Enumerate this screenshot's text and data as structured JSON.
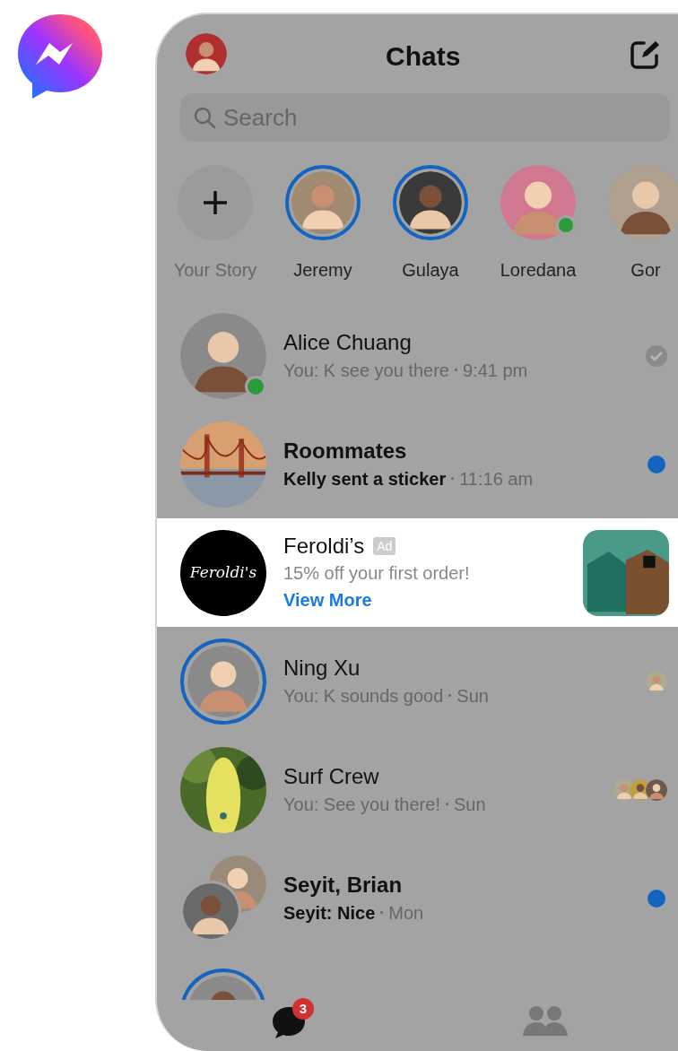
{
  "header": {
    "title": "Chats"
  },
  "search": {
    "placeholder": "Search"
  },
  "stories": [
    {
      "kind": "add",
      "name": "Your Story"
    },
    {
      "kind": "story",
      "name": "Jeremy",
      "unseen": true,
      "online": false
    },
    {
      "kind": "story",
      "name": "Gulaya",
      "unseen": true,
      "online": false
    },
    {
      "kind": "story",
      "name": "Loredana",
      "unseen": false,
      "online": true
    },
    {
      "kind": "story",
      "name": "Gor",
      "unseen": false,
      "online": false
    }
  ],
  "chats": [
    {
      "kind": "chat",
      "name": "Alice Chuang",
      "preview": "You: K see you there",
      "time": "9:41 pm",
      "unread": false,
      "online": true,
      "story": false,
      "avatar": {
        "kind": "person"
      },
      "receipt": {
        "kind": "check"
      }
    },
    {
      "kind": "chat",
      "name": "Roommates",
      "preview": "Kelly sent a sticker",
      "time": "11:16 am",
      "unread": true,
      "online": false,
      "story": false,
      "avatar": {
        "kind": "bridge"
      },
      "receipt": {
        "kind": "dot"
      }
    },
    {
      "kind": "ad",
      "name": "Feroldi’s",
      "badge": "Ad",
      "logo_text": "Feroldi's",
      "preview": "15% off your first order!",
      "link": "View More"
    },
    {
      "kind": "chat",
      "name": "Ning Xu",
      "preview": "You: K sounds good",
      "time": "Sun",
      "unread": false,
      "online": false,
      "story": true,
      "avatar": {
        "kind": "person"
      },
      "receipt": {
        "kind": "avatars"
      }
    },
    {
      "kind": "chat",
      "name": "Surf Crew",
      "preview": "You: See you there!",
      "time": "Sun",
      "unread": false,
      "online": false,
      "story": false,
      "avatar": {
        "kind": "surfboard"
      },
      "receipt": {
        "kind": "avatars"
      }
    },
    {
      "kind": "chat",
      "name": "Seyit, Brian",
      "preview": "Seyit: Nice",
      "time": "Mon",
      "unread": true,
      "online": false,
      "story": false,
      "avatar": {
        "kind": "pair"
      },
      "receipt": {
        "kind": "dot"
      }
    },
    {
      "kind": "partial",
      "story": true
    }
  ],
  "tabs": [
    {
      "kind": "chat",
      "badge": "3",
      "selected": true
    },
    {
      "kind": "people",
      "selected": false
    }
  ]
}
